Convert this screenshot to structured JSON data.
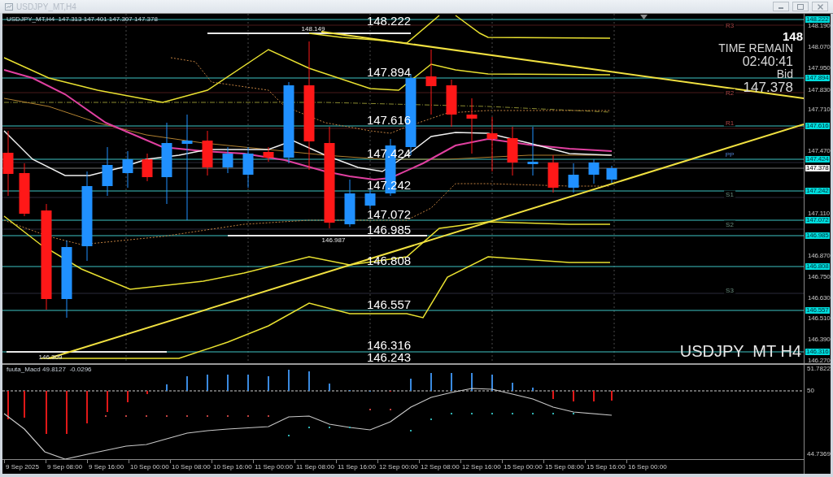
{
  "window": {
    "title": "USDJPY_MT,H4"
  },
  "chart": {
    "header": "USDJPY_MT,H4  147.313 147.401 147.307 147.378",
    "level_labels": [
      "148.222",
      "147.894",
      "147.616",
      "147.424",
      "147.242",
      "147.072",
      "146.985",
      "146.808",
      "146.557",
      "146.316",
      "146.243"
    ],
    "marker_labels": [
      "148.149",
      "146.987",
      "146.309"
    ],
    "pivots": [
      {
        "label": "R3",
        "kind": "resistance"
      },
      {
        "label": "R2",
        "kind": "resistance"
      },
      {
        "label": "R1",
        "kind": "resistance"
      },
      {
        "label": "PP",
        "kind": "pivot"
      },
      {
        "label": "S1",
        "kind": "support"
      },
      {
        "label": "S2",
        "kind": "support"
      },
      {
        "label": "S3",
        "kind": "support"
      }
    ],
    "info": {
      "price_head": "148",
      "countdown_title": "TIME REMAIN",
      "countdown": "02:40:41",
      "bid_label": "Bid",
      "bid": "147.378"
    },
    "symbol_label": "USDJPY  MT H4",
    "price_axis": [
      {
        "text": "148.222",
        "kind": "tag"
      },
      {
        "text": "148.190",
        "kind": "tick"
      },
      {
        "text": "148.070",
        "kind": "tick"
      },
      {
        "text": "147.950",
        "kind": "tick"
      },
      {
        "text": "147.894",
        "kind": "tag"
      },
      {
        "text": "147.830",
        "kind": "tick"
      },
      {
        "text": "147.710",
        "kind": "tick"
      },
      {
        "text": "147.616",
        "kind": "tag"
      },
      {
        "text": "147.470",
        "kind": "tick"
      },
      {
        "text": "147.424",
        "kind": "tag"
      },
      {
        "text": "147.378",
        "kind": "bid"
      },
      {
        "text": "147.242",
        "kind": "tag"
      },
      {
        "text": "147.110",
        "kind": "tick"
      },
      {
        "text": "147.072",
        "kind": "tag"
      },
      {
        "text": "146.985",
        "kind": "tag"
      },
      {
        "text": "146.870",
        "kind": "tick"
      },
      {
        "text": "146.808",
        "kind": "tag"
      },
      {
        "text": "146.750",
        "kind": "tick"
      },
      {
        "text": "146.630",
        "kind": "tick"
      },
      {
        "text": "146.557",
        "kind": "tag"
      },
      {
        "text": "146.510",
        "kind": "tick"
      },
      {
        "text": "146.390",
        "kind": "tick"
      },
      {
        "text": "146.316",
        "kind": "tag"
      },
      {
        "text": "146.270",
        "kind": "tick"
      }
    ]
  },
  "macd": {
    "header": "fuuta_Macd 49.8127  -0.0296",
    "axis": [
      "51.7822",
      "50",
      "44.7369"
    ]
  },
  "time_axis": [
    "9 Sep 2025",
    "9 Sep 08:00",
    "9 Sep 16:00",
    "10 Sep 00:00",
    "10 Sep 08:00",
    "10 Sep 16:00",
    "11 Sep 00:00",
    "11 Sep 08:00",
    "11 Sep 16:00",
    "12 Sep 00:00",
    "12 Sep 08:00",
    "12 Sep 16:00",
    "15 Sep 00:00",
    "15 Sep 08:00",
    "15 Sep 16:00",
    "16 Sep 00:00"
  ]
}
